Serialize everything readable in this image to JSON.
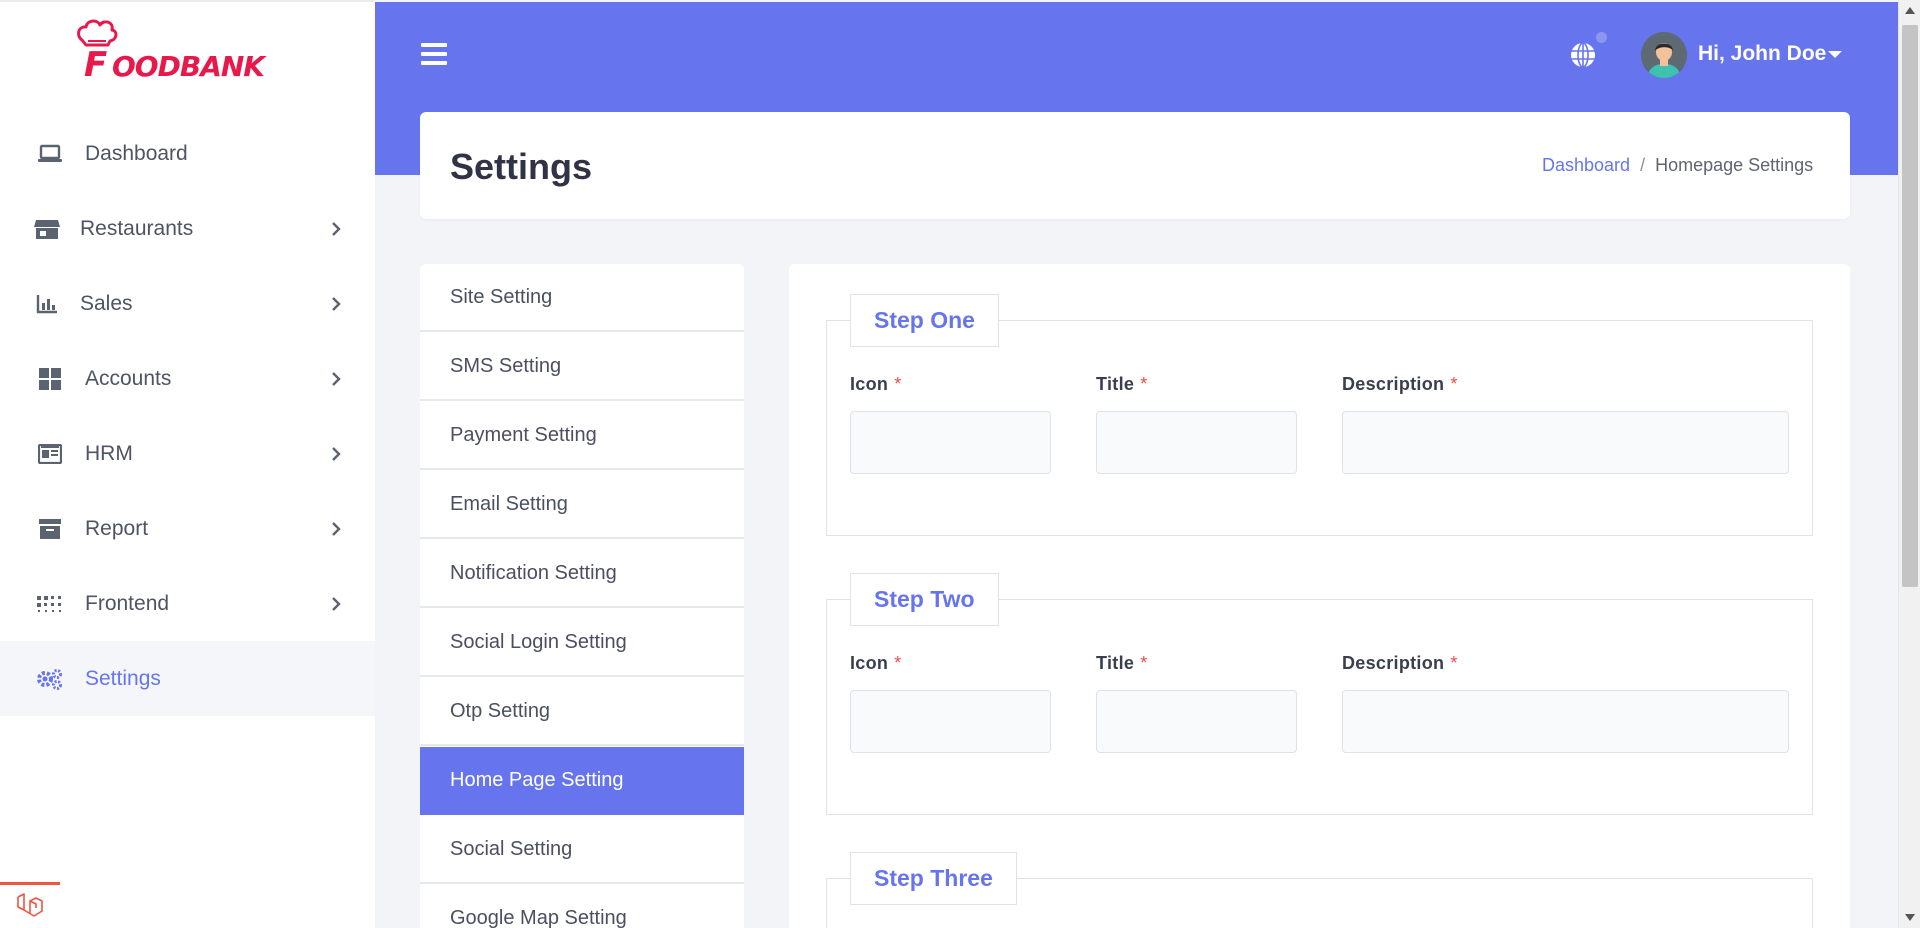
{
  "brand": {
    "logo_text": "FOODBANK",
    "accent_color": "#6675ee",
    "logo_color": "#e8194a"
  },
  "sidebar": {
    "items": [
      {
        "label": "Dashboard",
        "icon": "laptop-icon",
        "has_children": false
      },
      {
        "label": "Restaurants",
        "icon": "store-icon",
        "has_children": true
      },
      {
        "label": "Sales",
        "icon": "bar-chart-icon",
        "has_children": true
      },
      {
        "label": "Accounts",
        "icon": "grid-icon",
        "has_children": true
      },
      {
        "label": "HRM",
        "icon": "id-card-icon",
        "has_children": true
      },
      {
        "label": "Report",
        "icon": "archive-icon",
        "has_children": true
      },
      {
        "label": "Frontend",
        "icon": "dots-grid-icon",
        "has_children": true
      },
      {
        "label": "Settings",
        "icon": "gears-icon",
        "has_children": false,
        "active": true
      }
    ]
  },
  "header": {
    "user_greeting": "Hi, John Doe",
    "icons": [
      "menu-icon",
      "globe-icon",
      "avatar",
      "caret-down-icon"
    ]
  },
  "page": {
    "title": "Settings",
    "breadcrumb": {
      "home": "Dashboard",
      "separator": "/",
      "current": "Homepage Settings"
    }
  },
  "settings_menu": {
    "items": [
      "Site Setting",
      "SMS Setting",
      "Payment Setting",
      "Email Setting",
      "Notification Setting",
      "Social Login Setting",
      "Otp Setting",
      "Home Page Setting",
      "Social Setting",
      "Google Map Setting"
    ],
    "active": "Home Page Setting"
  },
  "form": {
    "steps": [
      {
        "legend": "Step One",
        "fields": {
          "icon": "Icon",
          "title": "Title",
          "description": "Description"
        },
        "values": {
          "icon": "",
          "title": "",
          "description": ""
        }
      },
      {
        "legend": "Step Two",
        "fields": {
          "icon": "Icon",
          "title": "Title",
          "description": "Description"
        },
        "values": {
          "icon": "",
          "title": "",
          "description": ""
        }
      },
      {
        "legend": "Step Three"
      }
    ],
    "required_mark": "*"
  }
}
